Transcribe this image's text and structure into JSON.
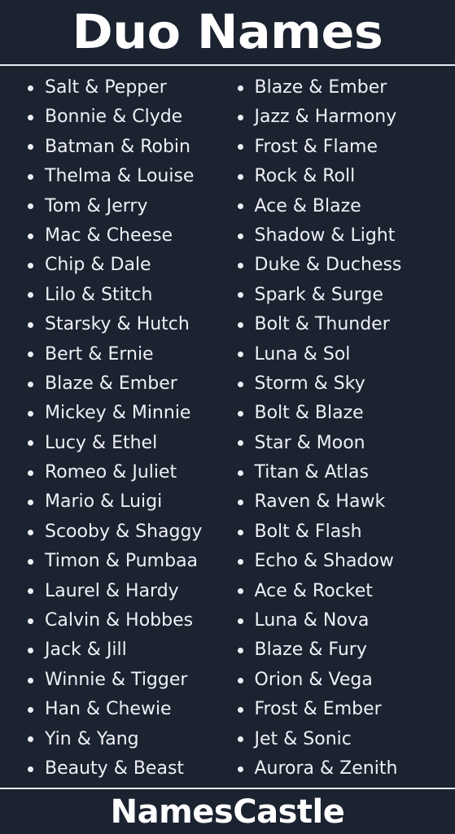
{
  "theme": {
    "background": "#1b2230",
    "text": "#eef0f5",
    "title_color": "#ffffff",
    "divider_color": "#e8eaf0"
  },
  "header": {
    "title": "Duo Names"
  },
  "footer": {
    "brand": "NamesCastle"
  },
  "columns": [
    {
      "id": "left",
      "items": [
        "Salt & Pepper",
        "Bonnie & Clyde",
        "Batman & Robin",
        "Thelma & Louise",
        "Tom & Jerry",
        "Mac & Cheese",
        "Chip & Dale",
        "Lilo & Stitch",
        "Starsky & Hutch",
        "Bert & Ernie",
        "Blaze & Ember",
        "Mickey & Minnie",
        "Lucy & Ethel",
        "Romeo & Juliet",
        "Mario & Luigi",
        "Scooby & Shaggy",
        "Timon & Pumbaa",
        "Laurel & Hardy",
        "Calvin & Hobbes",
        "Jack & Jill",
        "Winnie & Tigger",
        "Han & Chewie",
        "Yin & Yang",
        "Beauty & Beast"
      ]
    },
    {
      "id": "right",
      "items": [
        "Blaze & Ember",
        "Jazz & Harmony",
        "Frost & Flame",
        "Rock & Roll",
        "Ace & Blaze",
        "Shadow & Light",
        "Duke & Duchess",
        "Spark & Surge",
        "Bolt & Thunder",
        "Luna & Sol",
        "Storm & Sky",
        "Bolt & Blaze",
        "Star & Moon",
        "Titan & Atlas",
        "Raven & Hawk",
        "Bolt & Flash",
        "Echo & Shadow",
        "Ace & Rocket",
        "Luna & Nova",
        "Blaze & Fury",
        "Orion & Vega",
        "Frost & Ember",
        "Jet & Sonic",
        "Aurora & Zenith"
      ]
    }
  ]
}
